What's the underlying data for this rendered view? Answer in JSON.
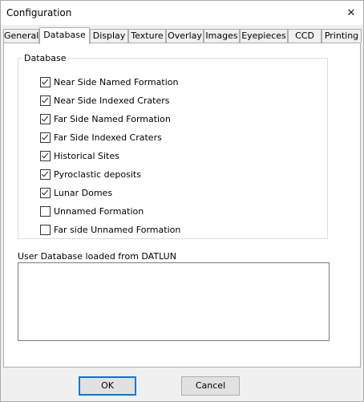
{
  "window": {
    "title": "Configuration"
  },
  "tabs": [
    {
      "label": "General",
      "active": false
    },
    {
      "label": "Database",
      "active": true
    },
    {
      "label": "Display",
      "active": false
    },
    {
      "label": "Texture",
      "active": false
    },
    {
      "label": "Overlay",
      "active": false
    },
    {
      "label": "Images",
      "active": false
    },
    {
      "label": "Eyepieces",
      "active": false
    },
    {
      "label": "CCD",
      "active": false
    },
    {
      "label": "Printing",
      "active": false
    }
  ],
  "database_group": {
    "legend": "Database",
    "items": [
      {
        "label": "Near Side Named Formation",
        "checked": true
      },
      {
        "label": "Near Side Indexed Craters",
        "checked": true
      },
      {
        "label": "Far Side Named Formation",
        "checked": true
      },
      {
        "label": "Far Side Indexed Craters",
        "checked": true
      },
      {
        "label": "Historical Sites",
        "checked": true
      },
      {
        "label": "Pyroclastic deposits",
        "checked": true
      },
      {
        "label": "Lunar Domes",
        "checked": true
      },
      {
        "label": "Unnamed Formation",
        "checked": false
      },
      {
        "label": "Far side Unnamed Formation",
        "checked": false
      }
    ]
  },
  "user_database": {
    "label": "User Database loaded from DATLUN",
    "value": ""
  },
  "buttons": {
    "ok": "OK",
    "cancel": "Cancel"
  },
  "colors": {
    "accent": "#0078d7",
    "panel_bg": "#ffffff",
    "window_bg": "#f0f0f0"
  },
  "icons": {
    "close": "close-icon"
  }
}
